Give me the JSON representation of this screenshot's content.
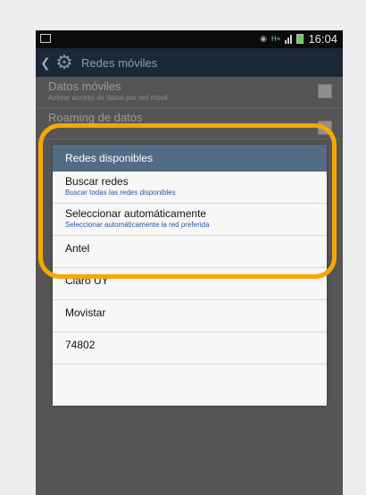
{
  "status_bar": {
    "time": "16:04",
    "network": "H+"
  },
  "action_bar": {
    "title": "Redes móviles",
    "icons": [
      "back-arrow-icon",
      "gear-icon"
    ]
  },
  "settings": {
    "items": [
      {
        "title": "Datos móviles",
        "subtitle": "Activar acceso de datos por red móvil",
        "checked": true
      },
      {
        "title": "Roaming de datos",
        "subtitle": "",
        "checked": false
      }
    ]
  },
  "dialog": {
    "title": "Redes disponibles",
    "options": [
      {
        "title": "Buscar redes",
        "subtitle": "Buscar todas las redes disponibles"
      },
      {
        "title": "Seleccionar automáticamente",
        "subtitle": "Seleccionar automáticamente la red preferida"
      }
    ],
    "networks": [
      "Antel",
      "Claro UY",
      "Movistar",
      "74802"
    ]
  },
  "colors": {
    "highlight": "#f5a800",
    "dialog_header": "#536c86",
    "action_bar": "#1b2836"
  }
}
